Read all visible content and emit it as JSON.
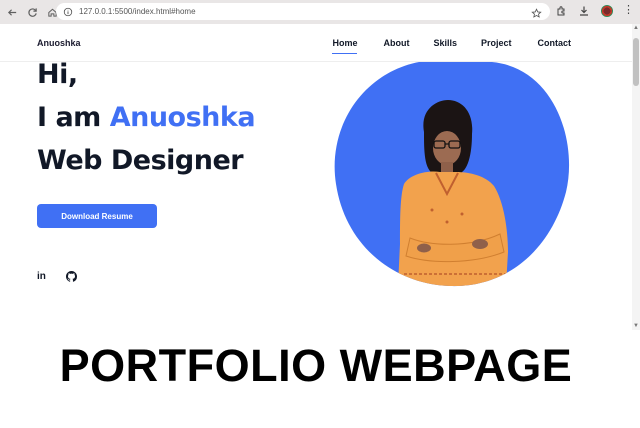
{
  "browser": {
    "url": "127.0.0.1:5500/index.html#home",
    "icons": [
      "back-icon",
      "reload-icon",
      "home-icon",
      "site-info-icon",
      "bookmark-star-icon",
      "extensions-icon",
      "download-icon",
      "profile-avatar",
      "menu-icon"
    ]
  },
  "site": {
    "logo": "Anuoshka",
    "nav": [
      "Home",
      "About",
      "Skills",
      "Project",
      "Contact"
    ],
    "active_nav": "Home",
    "accent_color": "#4070f4",
    "text_color": "#111827"
  },
  "hero": {
    "greeting": "Hi,",
    "intro_prefix": "I am ",
    "name": "Anuoshka",
    "role": "Web Designer",
    "button_label": "Download Resume",
    "social": [
      {
        "icon": "linkedin-icon",
        "label": "in"
      },
      {
        "icon": "github-icon",
        "label": ""
      }
    ]
  },
  "caption": "PORTFOLIO WEBPAGE"
}
